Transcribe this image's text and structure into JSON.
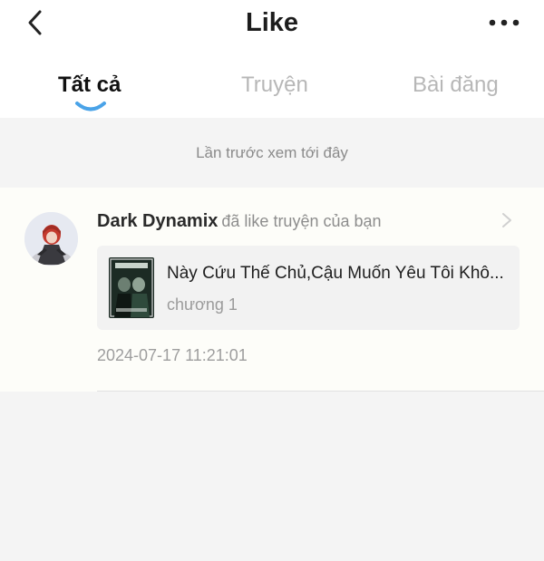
{
  "header": {
    "title": "Like",
    "back_icon": "chevron-left-icon",
    "more_icon": "more-horizontal-icon"
  },
  "tabs": [
    {
      "label": "Tất cả",
      "active": true
    },
    {
      "label": "Truyện",
      "active": false
    },
    {
      "label": "Bài đăng",
      "active": false
    }
  ],
  "notice": "Lần trước xem tới đây",
  "notification": {
    "username": "Dark Dynamix",
    "action": "đã like truyện của bạn",
    "story_title": "Này Cứu Thế Chủ,Cậu Muốn Yêu Tôi Khô...",
    "chapter": "chương 1",
    "timestamp": "2024-07-17 11:21:01"
  },
  "colors": {
    "accent": "#4aa3e8",
    "background": "#f4f4f4",
    "card": "#fdfdf9",
    "inactive_tab": "#b7b7b7"
  }
}
